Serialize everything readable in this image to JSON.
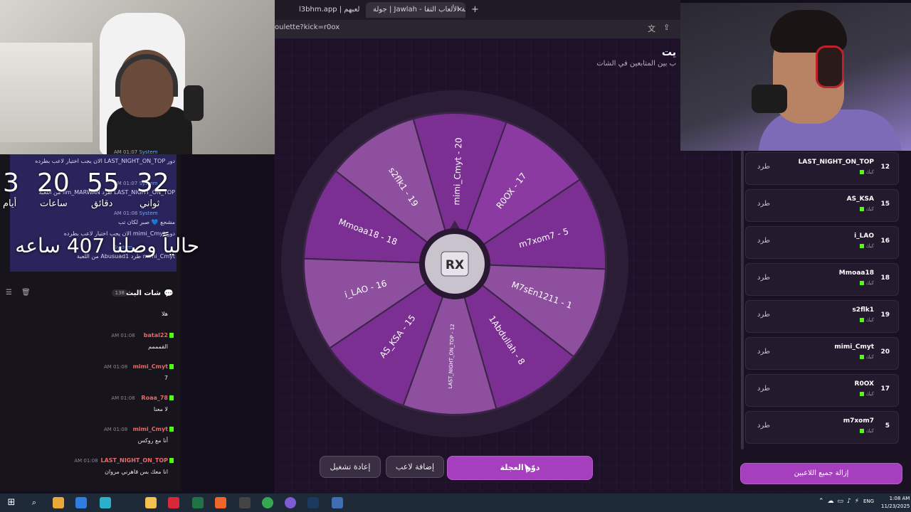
{
  "browser": {
    "tabs": [
      {
        "label": "l3bhm.app | لعبهم"
      },
      {
        "label": "جولة | Jawlah - منصة الألعاب التفا"
      }
    ],
    "new_tab": "+",
    "url": "oulette?kick=r0ox",
    "tab_close": "×"
  },
  "page": {
    "title": "يت",
    "subtitle": "ب بين المتابعين في الشات"
  },
  "wheel": {
    "center_logo": "RX",
    "segments": [
      {
        "label": "R0OX - 17",
        "color": "#8a3aa1"
      },
      {
        "label": "m7xom7 - 5",
        "color": "#7b2f93"
      },
      {
        "label": "M7sEn1211 - 1",
        "color": "#8d4f9e"
      },
      {
        "label": "1Abdullah - 8",
        "color": "#7b2f93"
      },
      {
        "label": "LAST_NIGHT_ON_TOP - 12",
        "color": "#8d4f9e"
      },
      {
        "label": "AS_KSA - 15",
        "color": "#7b2f93"
      },
      {
        "label": "i_LAO - 16",
        "color": "#8d4f9e"
      },
      {
        "label": "Mmoaa18 - 18",
        "color": "#7b2f93"
      },
      {
        "label": "s2flk1 - 19",
        "color": "#8d4f9e"
      },
      {
        "label": "mimi_Cmyt - 20",
        "color": "#7b2f93"
      }
    ]
  },
  "actions": {
    "spin": "دوّر العجلة",
    "add_player": "إضافة لاعب",
    "restart": "إعادة تشغيل",
    "remove_all": "إزالة جميع اللاعبين"
  },
  "players": [
    {
      "name": "LAST_NIGHT_ON_TOP",
      "num": "12",
      "platform": "كيك",
      "kick": "طرد"
    },
    {
      "name": "AS_KSA",
      "num": "15",
      "platform": "كيك",
      "kick": "طرد"
    },
    {
      "name": "i_LAO",
      "num": "16",
      "platform": "كيك",
      "kick": "طرد"
    },
    {
      "name": "Mmoaa18",
      "num": "18",
      "platform": "كيك",
      "kick": "طرد"
    },
    {
      "name": "s2flk1",
      "num": "19",
      "platform": "كيك",
      "kick": "طرد"
    },
    {
      "name": "mimi_Cmyt",
      "num": "20",
      "platform": "كيك",
      "kick": "طرد"
    },
    {
      "name": "R0OX",
      "num": "17",
      "platform": "كيك",
      "kick": "طرد"
    },
    {
      "name": "m7xom7",
      "num": "5",
      "platform": "كيك",
      "kick": "طرد"
    }
  ],
  "overlay": {
    "system_lines": [
      {
        "time": "AM 01:07",
        "name": "System",
        "text": "دور LAST_NIGHT_ON_TOP الان يجب اختيار لاعب بطرده"
      },
      {
        "time": "AM 01:07",
        "name": "System",
        "text": "LAST_NIGHT_ON_TOP طرد iim_MARWAN من اللعبة"
      },
      {
        "time": "AM 01:08",
        "name": "System",
        "text": "مشجع 💙 صبر لكان تب"
      },
      {
        "time": "",
        "name": "",
        "text": "دور mimi_Cmyt الان يجب اختيار لاعب بطرده"
      },
      {
        "time": "",
        "name": "System",
        "text": "mimi_Cmyt طرد Abusuad1 من اللعبة"
      }
    ],
    "countdown": {
      "days": "3",
      "hours": "20",
      "minutes": "55",
      "seconds": "32",
      "days_label": "أيام",
      "hours_label": "ساعات",
      "minutes_label": "دقائق",
      "seconds_label": "ثواني"
    },
    "reached": "حالياً وصلنا 407 ساعه"
  },
  "chat": {
    "title": "شات البث",
    "count": "138",
    "messages": [
      {
        "user": "",
        "time": "",
        "text": "هلا",
        "color": "#e9e4ee"
      },
      {
        "user": "batal22",
        "time": "AM 01:08",
        "text": "القمممم",
        "color": "#e86a6a"
      },
      {
        "user": "mimi_Cmyt",
        "time": "AM 01:08",
        "text": "7",
        "color": "#e86a6a"
      },
      {
        "user": "Roaa_78",
        "time": "AM 01:08",
        "text": "لا معنا",
        "color": "#e86a6a"
      },
      {
        "user": "mimi_Cmyt",
        "time": "AM 01:08",
        "text": "أنا مع روكس",
        "color": "#e86a6a"
      },
      {
        "user": "LAST_NIGHT_ON_TOP",
        "time": "AM 01:08",
        "text": "انا معك بس قاهرني مروان",
        "color": "#e86a6a"
      }
    ]
  },
  "taskbar": {
    "lang": "ENG",
    "time": "1:08 AM",
    "date": "11/23/2025"
  }
}
